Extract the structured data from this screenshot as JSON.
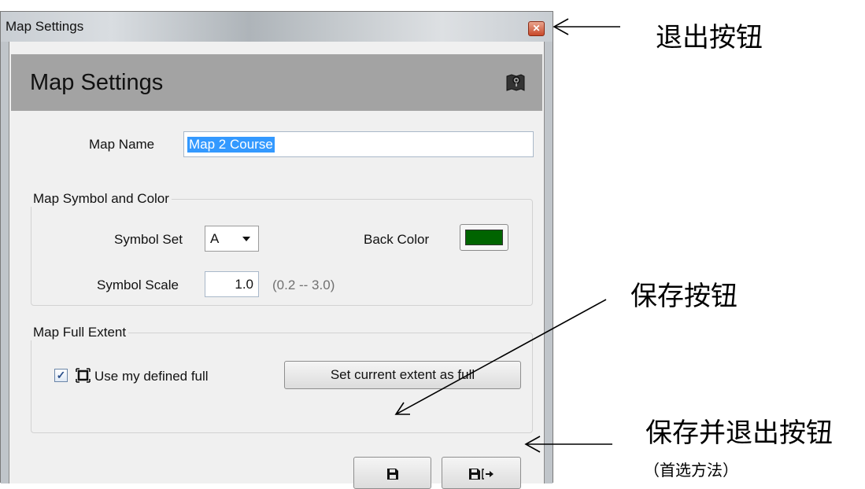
{
  "window": {
    "title": "Map Settings",
    "close_icon": "close-icon"
  },
  "header": {
    "title": "Map Settings",
    "icon": "map-icon"
  },
  "form": {
    "map_name_label": "Map Name",
    "map_name_value": "Map 2 Course",
    "symbol_group": {
      "legend": "Map Symbol and Color",
      "symbol_set_label": "Symbol Set",
      "symbol_set_value": "A",
      "back_color_label": "Back Color",
      "back_color": "#006400",
      "symbol_scale_label": "Symbol Scale",
      "symbol_scale_value": "1.0",
      "symbol_scale_range": "(0.2 -- 3.0)"
    },
    "extent_group": {
      "legend": "Map Full Extent",
      "use_defined_full_label": "Use my defined full",
      "use_defined_full_checked": true,
      "set_current_extent_label": "Set current extent as full"
    }
  },
  "footer": {
    "save_icon": "save-icon",
    "save_exit_icon": "save-exit-icon"
  },
  "annotations": {
    "exit_button": "退出按钮",
    "save_button": "保存按钮",
    "save_and_exit_button": "保存并退出按钮",
    "preferred_method": "（首选方法）"
  }
}
